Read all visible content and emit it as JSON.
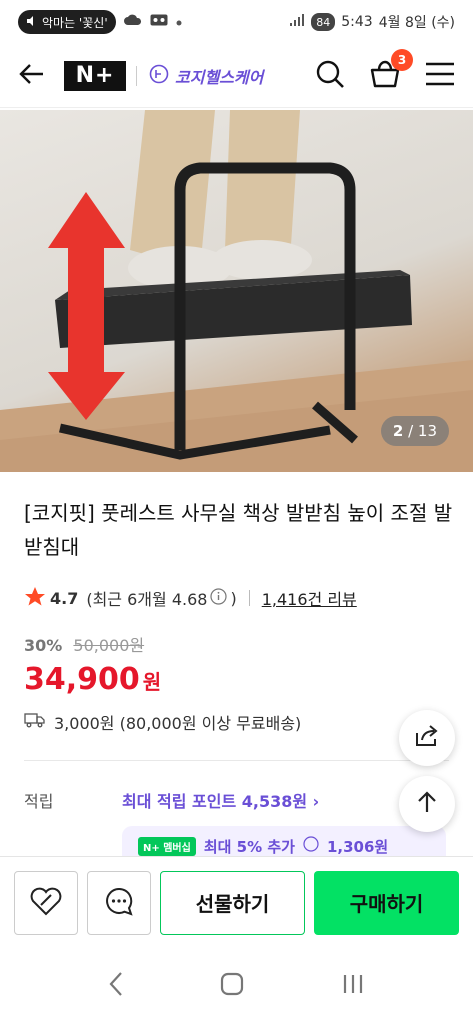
{
  "status_bar": {
    "notification": "악마는 '꽃신'",
    "battery": "84",
    "time": "5:43",
    "date": "4월 8일 (수)"
  },
  "header": {
    "logo": "N+",
    "brand": "코지헬스케어",
    "cart_count": "3"
  },
  "hero": {
    "image_index": "2",
    "image_total": "/ 13"
  },
  "product": {
    "title": "[코지핏] 풋레스트 사무실 책상 발받침 높이 조절 발받침대",
    "rating": "4.7",
    "recent_rating": "(최근 6개월 4.68",
    "recent_rating_close": ")",
    "review_count": "1,416건 리뷰",
    "discount": "30%",
    "original_price": "50,000원",
    "sale_price": "34,900",
    "currency": "원",
    "shipping": "3,000원 (80,000원 이상 무료배송)"
  },
  "points": {
    "label": "적립",
    "value": "최대 적립 포인트 4,538원 ›",
    "chip": "N+ 멤버십",
    "extra": "최대 5% 추가",
    "extra_points": "1,306원"
  },
  "actions": {
    "gift": "선물하기",
    "buy": "구매하기"
  },
  "colors": {
    "accent_green": "#03c75a",
    "price_red": "#e5172b",
    "brand_purple": "#6a4fd6",
    "badge_orange": "#ff4b26"
  }
}
